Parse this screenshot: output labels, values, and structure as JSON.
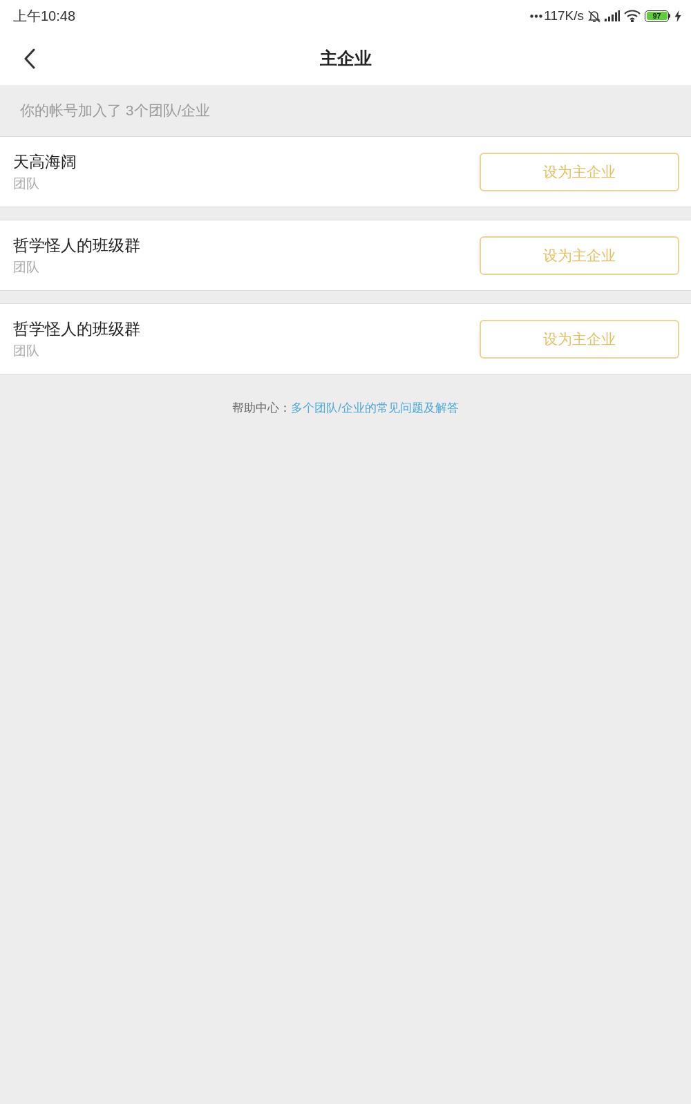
{
  "status_bar": {
    "time": "上午10:48",
    "network_speed": "117K/s",
    "battery": "97"
  },
  "header": {
    "title": "主企业"
  },
  "summary": "你的帐号加入了 3个团队/企业",
  "teams": [
    {
      "name": "天高海阔",
      "type": "团队",
      "button": "设为主企业"
    },
    {
      "name": "哲学怪人的班级群",
      "type": "团队",
      "button": "设为主企业"
    },
    {
      "name": "哲学怪人的班级群",
      "type": "团队",
      "button": "设为主企业"
    }
  ],
  "help": {
    "label": "帮助中心：",
    "link": "多个团队/企业的常见问题及解答"
  }
}
